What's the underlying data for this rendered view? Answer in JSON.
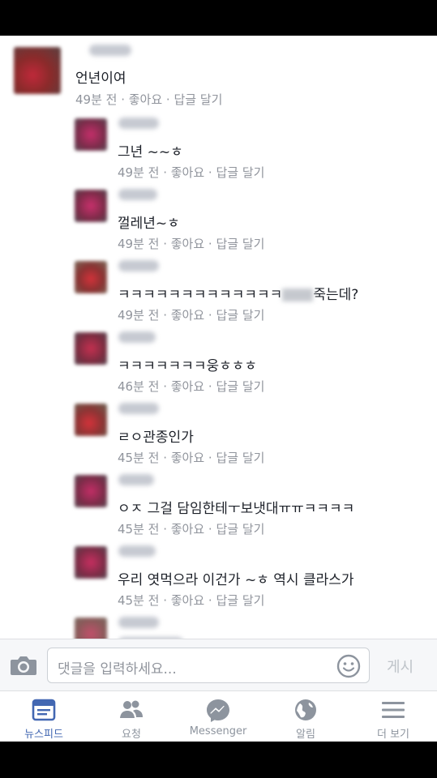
{
  "comments": [
    {
      "text": "언년이여",
      "meta": "49분 전 · 좋아요 · 답글 달기"
    },
    {
      "text": "그년 ~~ㅎ",
      "meta": "49분 전 · 좋아요 · 답글 달기"
    },
    {
      "text": "껄레년~ㅎ",
      "meta": "49분 전 · 좋아요 · 답글 달기"
    },
    {
      "text_before": "ㅋㅋㅋㅋㅋㅋㅋㅋㅋㅋㅋㅋㅋ",
      "text_after": "죽는데?",
      "meta": "49분 전 · 좋아요 · 답글 달기"
    },
    {
      "text": "ㅋㅋㅋㅋㅋㅋㅋ웅ㅎㅎㅎ",
      "meta": "46분 전 · 좋아요 · 답글 달기"
    },
    {
      "text": "ㄹㅇ관종인가",
      "meta": "45분 전 · 좋아요 · 답글 달기"
    },
    {
      "text": "ㅇㅈ 그걸 담임한테ㅜ보냇대ㅠㅠㅋㅋㅋㅋ",
      "meta": "45분 전 · 좋아요 · 답글 달기"
    },
    {
      "text": "우리 엿먹으라 이건가 ~ㅎ 역시 클라스가",
      "meta": "45분 전 · 좋아요 · 답글 달기"
    }
  ],
  "input": {
    "placeholder": "댓글을 입력하세요...",
    "post_label": "게시"
  },
  "tabs": [
    {
      "label": "뉴스피드",
      "icon": "news-feed-icon",
      "active": true
    },
    {
      "label": "요청",
      "icon": "friend-requests-icon"
    },
    {
      "label": "Messenger",
      "icon": "messenger-icon"
    },
    {
      "label": "알림",
      "icon": "globe-notifications-icon"
    },
    {
      "label": "더 보기",
      "icon": "menu-icon"
    }
  ],
  "colors": {
    "accent": "#4267b2",
    "meta": "#90949c",
    "text": "#1d2129"
  }
}
